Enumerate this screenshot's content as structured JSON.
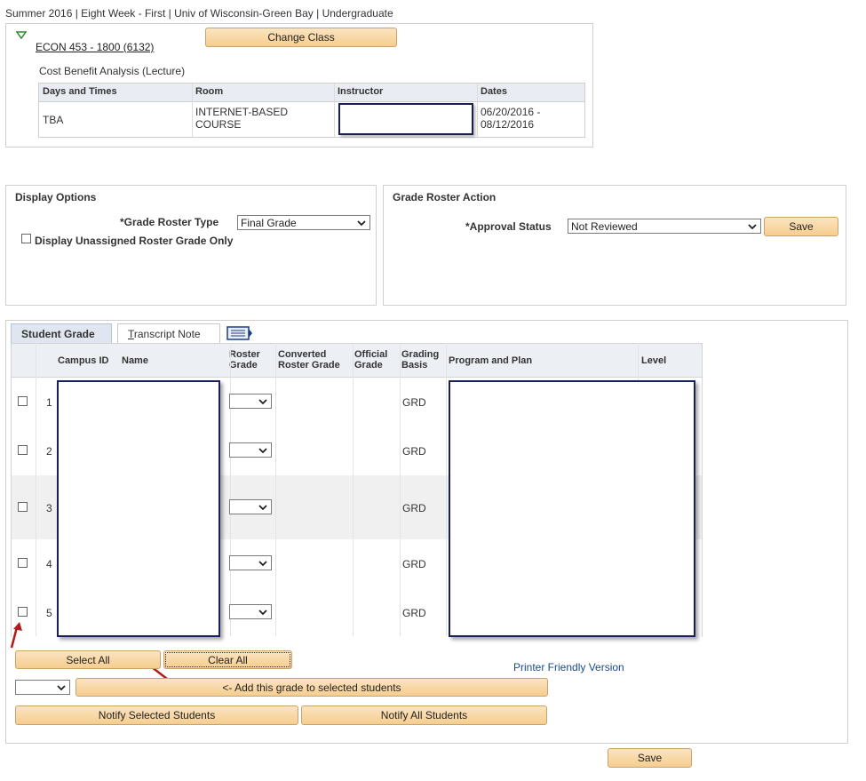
{
  "term_line": "Summer 2016 | Eight Week - First | Univ of Wisconsin-Green Bay | Undergraduate",
  "class_section": {
    "course_link": "ECON 453 - 1800 (6132)",
    "change_class_label": "Change Class",
    "description": "Cost Benefit Analysis (Lecture)",
    "columns": [
      "Days and Times",
      "Room",
      "Instructor",
      "Dates"
    ],
    "row": {
      "days_times": "TBA",
      "room_line1": "INTERNET-BASED",
      "room_line2": "COURSE",
      "instructor": "",
      "dates_line1": "06/20/2016 -",
      "dates_line2": "08/12/2016"
    }
  },
  "display_options": {
    "title": "Display Options",
    "roster_type_label": "*Grade Roster Type",
    "roster_type_value": "Final Grade",
    "unassigned_label": "Display Unassigned Roster Grade Only"
  },
  "roster_action": {
    "title": "Grade Roster Action",
    "approval_label": "*Approval Status",
    "approval_value": "Not Reviewed",
    "save_label": "Save"
  },
  "tabs": {
    "student_grade": "Student Grade",
    "transcript_note_prefix": "T",
    "transcript_note_rest": "ranscript Note"
  },
  "grid": {
    "headers": {
      "campus_id": "Campus ID",
      "name": "Name",
      "roster_grade_1": "Roster",
      "roster_grade_2": "Grade",
      "converted_1": "Converted",
      "converted_2": "Roster Grade",
      "official_1": "Official",
      "official_2": "Grade",
      "grading_1": "Grading",
      "grading_2": "Basis",
      "program_plan": "Program and Plan",
      "level": "Level"
    },
    "rows": [
      {
        "num": "1",
        "basis": "GRD"
      },
      {
        "num": "2",
        "basis": "GRD"
      },
      {
        "num": "3",
        "basis": "GRD"
      },
      {
        "num": "4",
        "basis": "GRD"
      },
      {
        "num": "5",
        "basis": "GRD"
      }
    ]
  },
  "actions": {
    "select_all": "Select All",
    "clear_all": "Clear All",
    "printer_friendly": "Printer Friendly Version",
    "add_grade": "<- Add this grade to selected students",
    "notify_selected": "Notify Selected Students",
    "notify_all": "Notify All Students",
    "save": "Save"
  },
  "colors": {
    "button_bg": "#f6cd8f",
    "link_blue": "#1a4a8a",
    "arrow_red": "#b01c1c",
    "redaction_border": "#1a1f5c"
  }
}
